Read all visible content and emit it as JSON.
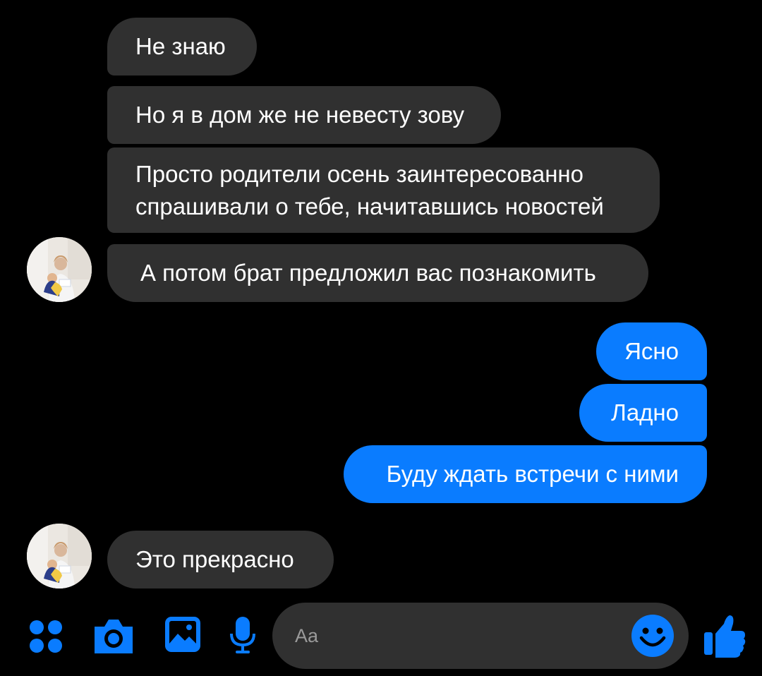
{
  "messages": [
    {
      "text": "Не знаю"
    },
    {
      "text": "Но я в дом же не невесту зову"
    },
    {
      "line1": "Просто родители осень заинтересованно",
      "line2": "спрашивали о тебе, начитавшись новостей"
    },
    {
      "text": "А потом брат предложил вас познакомить"
    },
    {
      "text": "Ясно"
    },
    {
      "text": "Ладно"
    },
    {
      "text": "Буду ждать встречи с ними"
    },
    {
      "text": "Это прекрасно"
    }
  ],
  "composer": {
    "placeholder": "Aa",
    "icons": [
      "apps-icon",
      "camera-icon",
      "gallery-icon",
      "microphone-icon",
      "emoji-icon",
      "like-thumb-icon"
    ]
  },
  "colors": {
    "background": "#000000",
    "incoming_bubble": "#303030",
    "outgoing_bubble": "#0a7cff",
    "accent": "#0a7cff"
  }
}
